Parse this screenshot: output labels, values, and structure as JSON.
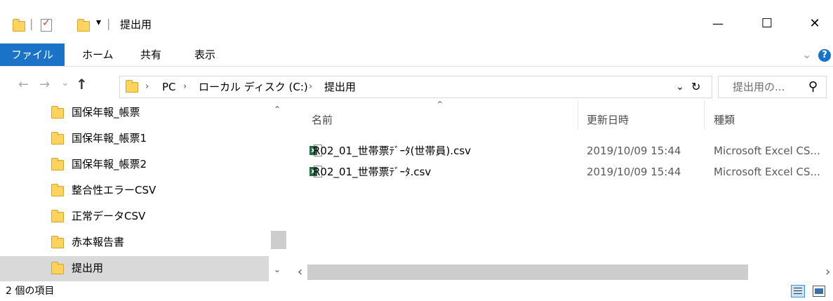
{
  "window": {
    "title": "提出用",
    "minimize_glyph": "—",
    "maximize_glyph": "☐",
    "close_glyph": "✕"
  },
  "qat": {
    "dropdown_glyph": "▾",
    "divider": "|"
  },
  "ribbon": {
    "tabs": [
      "ファイル",
      "ホーム",
      "共有",
      "表示"
    ],
    "expand_glyph": "⌄",
    "help_glyph": "?"
  },
  "nav": {
    "back_glyph": "←",
    "forward_glyph": "→",
    "recent_glyph": "⌄",
    "up_glyph": "↑"
  },
  "address": {
    "crumbs": [
      "PC",
      "ローカル ディスク (C:)",
      "提出用"
    ],
    "sep_glyph": "›",
    "dropdown_glyph": "⌄",
    "refresh_glyph": "↻"
  },
  "search": {
    "placeholder": "提出用の...",
    "icon_glyph": "⚲"
  },
  "sidebar": {
    "items": [
      "国保年報_帳票",
      "国保年報_帳票1",
      "国保年報_帳票2",
      "整合性エラーCSV",
      "正常データCSV",
      "赤本報告書",
      "提出用"
    ],
    "selected_index": 6,
    "scroll_up_glyph": "⌃",
    "scroll_down_glyph": "⌄"
  },
  "list": {
    "sort_glyph": "⌃",
    "columns": [
      "名前",
      "更新日時",
      "種類"
    ],
    "files": [
      {
        "name": "R02_01_世帯票ﾃﾞｰﾀ(世帯員).csv",
        "modified": "2019/10/09 15:44",
        "type": "Microsoft Excel CS..."
      },
      {
        "name": "R02_01_世帯票ﾃﾞｰﾀ.csv",
        "modified": "2019/10/09 15:44",
        "type": "Microsoft Excel CS..."
      }
    ],
    "h_scroll_left_glyph": "‹",
    "h_scroll_right_glyph": "›"
  },
  "status": {
    "item_count": "2 個の項目"
  },
  "colors": {
    "accent": "#1a73c7",
    "folder": "#ffd35c",
    "selected_bg": "#d9d9d9",
    "excel_green": "#1d7044"
  }
}
